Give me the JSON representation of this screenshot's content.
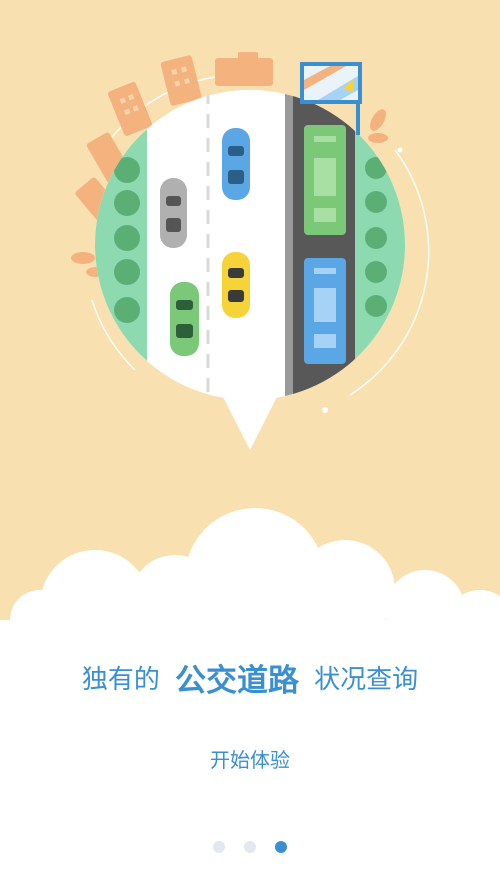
{
  "headline": {
    "prefix": "独有的",
    "emphasis": "公交道路",
    "suffix": "状况查询"
  },
  "start_button": {
    "label": "开始体验"
  },
  "pager": {
    "total": 3,
    "current": 3
  },
  "colors": {
    "background": "#F8E0B0",
    "accent": "#3A8FD0",
    "building": "#F4B37E",
    "road": "#585858",
    "bus_green": "#7CC879",
    "bus_blue": "#5BA6E5"
  }
}
